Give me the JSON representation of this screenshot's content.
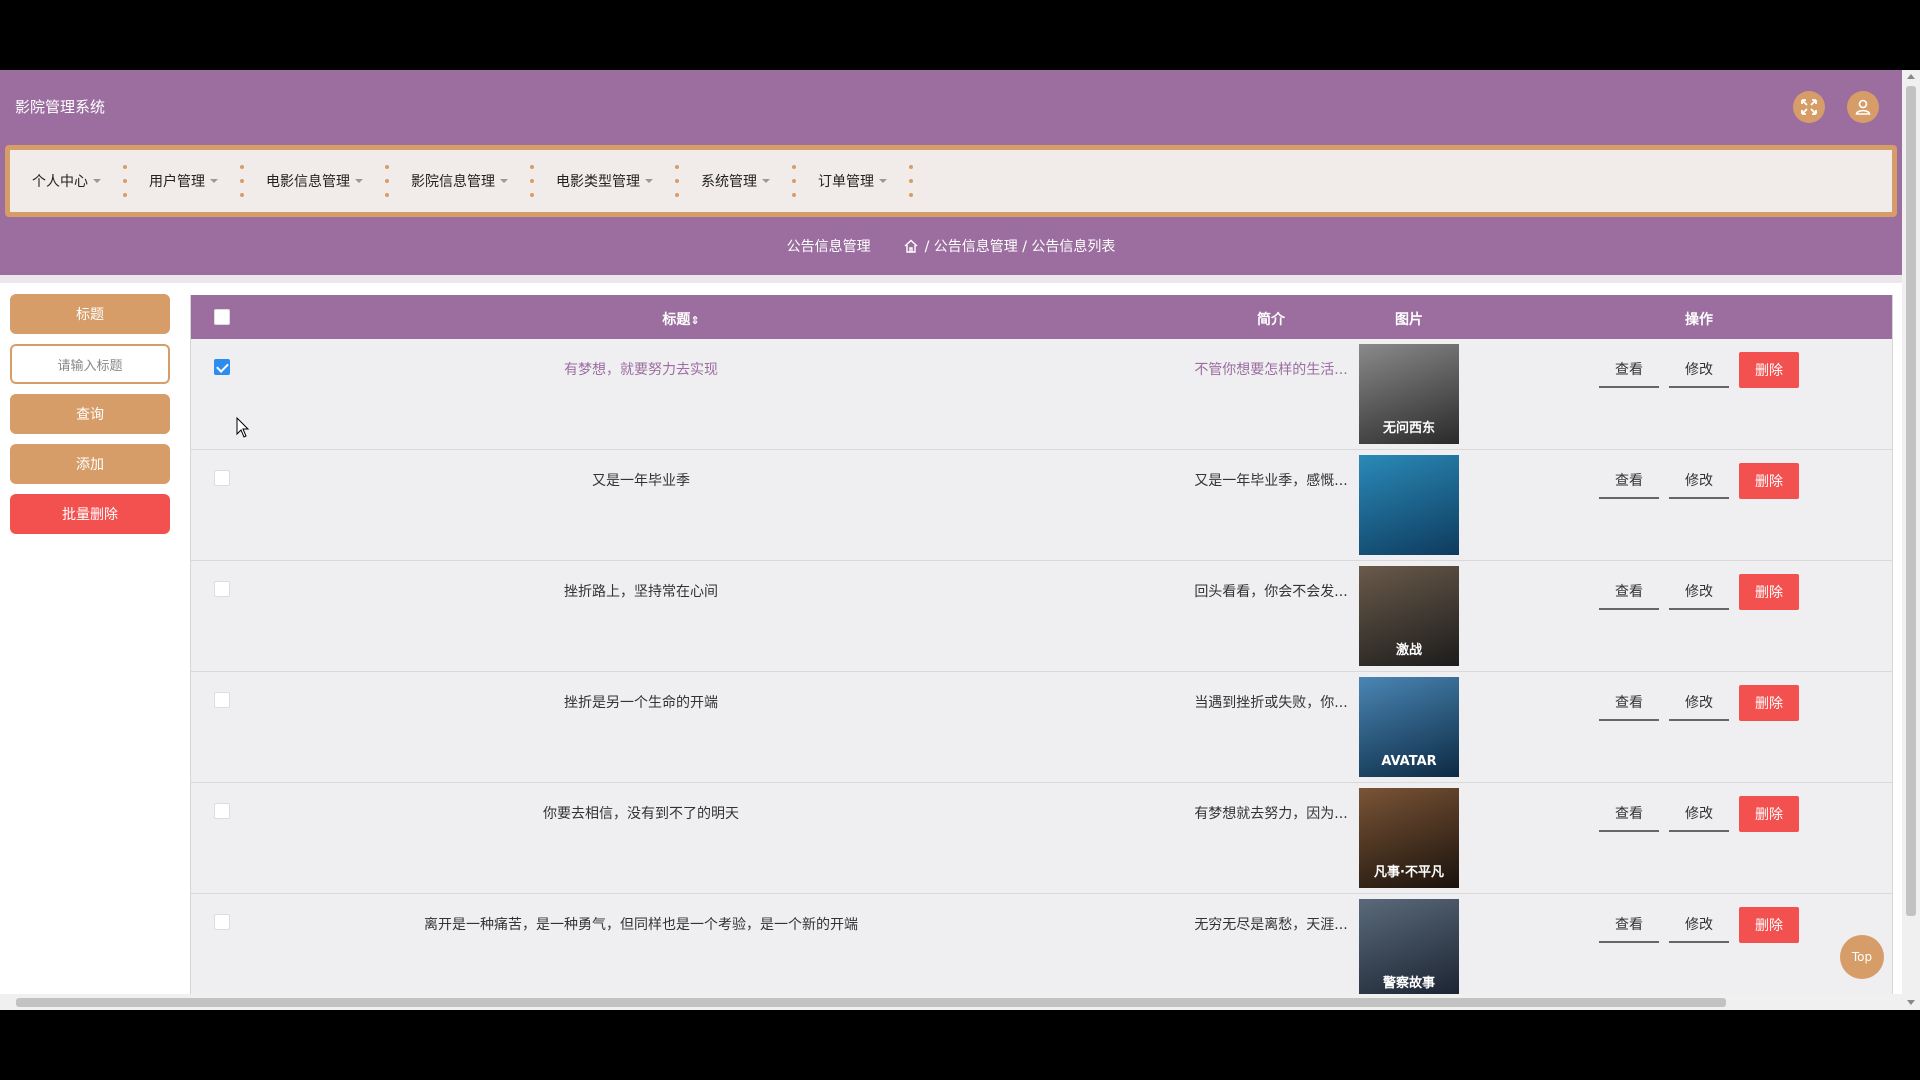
{
  "app": {
    "title": "影院管理系统"
  },
  "header": {
    "fullscreen_icon": "expand-icon",
    "user_icon": "user-icon"
  },
  "nav": {
    "items": [
      {
        "label": "个人中心"
      },
      {
        "label": "用户管理"
      },
      {
        "label": "电影信息管理"
      },
      {
        "label": "影院信息管理"
      },
      {
        "label": "电影类型管理"
      },
      {
        "label": "系统管理"
      },
      {
        "label": "订单管理"
      }
    ]
  },
  "breadcrumb": {
    "page_name": "公告信息管理",
    "path": "/ 公告信息管理 / 公告信息列表"
  },
  "sidebar": {
    "search_label": "标题",
    "search_placeholder": "请输入标题",
    "query_button": "查询",
    "add_button": "添加",
    "batch_delete_button": "批量删除"
  },
  "table": {
    "headers": {
      "title": "标题",
      "sort_icon": "⇕",
      "intro": "简介",
      "image": "图片",
      "actions": "操作"
    },
    "action_labels": {
      "view": "查看",
      "edit": "修改",
      "delete": "删除"
    },
    "rows": [
      {
        "checked": true,
        "title": "有梦想，就要努力去实现",
        "intro": "不管你想要怎样的生活...",
        "poster_text": "无问西东",
        "poster_colors": [
          "#2a2a2a",
          "#8a8a8a"
        ]
      },
      {
        "checked": false,
        "title": "又是一年毕业季",
        "intro": "又是一年毕业季，感慨...",
        "poster_text": "",
        "poster_colors": [
          "#0e3b5e",
          "#2a8ab8"
        ]
      },
      {
        "checked": false,
        "title": "挫折路上，坚持常在心间",
        "intro": "回头看看，你会不会发...",
        "poster_text": "激战",
        "poster_colors": [
          "#1c1c1c",
          "#6a5a4a"
        ]
      },
      {
        "checked": false,
        "title": "挫折是另一个生命的开端",
        "intro": "当遇到挫折或失败，你...",
        "poster_text": "AVATAR",
        "poster_colors": [
          "#0c2a44",
          "#4a86b4"
        ]
      },
      {
        "checked": false,
        "title": "你要去相信，没有到不了的明天",
        "intro": "有梦想就去努力，因为...",
        "poster_text": "凡事·不平凡",
        "poster_colors": [
          "#1a120c",
          "#7a5436"
        ]
      },
      {
        "checked": false,
        "title": "离开是一种痛苦，是一种勇气，但同样也是一个考验，是一个新的开端",
        "intro": "无穷无尽是离愁，天涯...",
        "poster_text": "警察故事",
        "poster_colors": [
          "#1a2230",
          "#5a6a7a"
        ]
      }
    ]
  },
  "top_button": "Top"
}
